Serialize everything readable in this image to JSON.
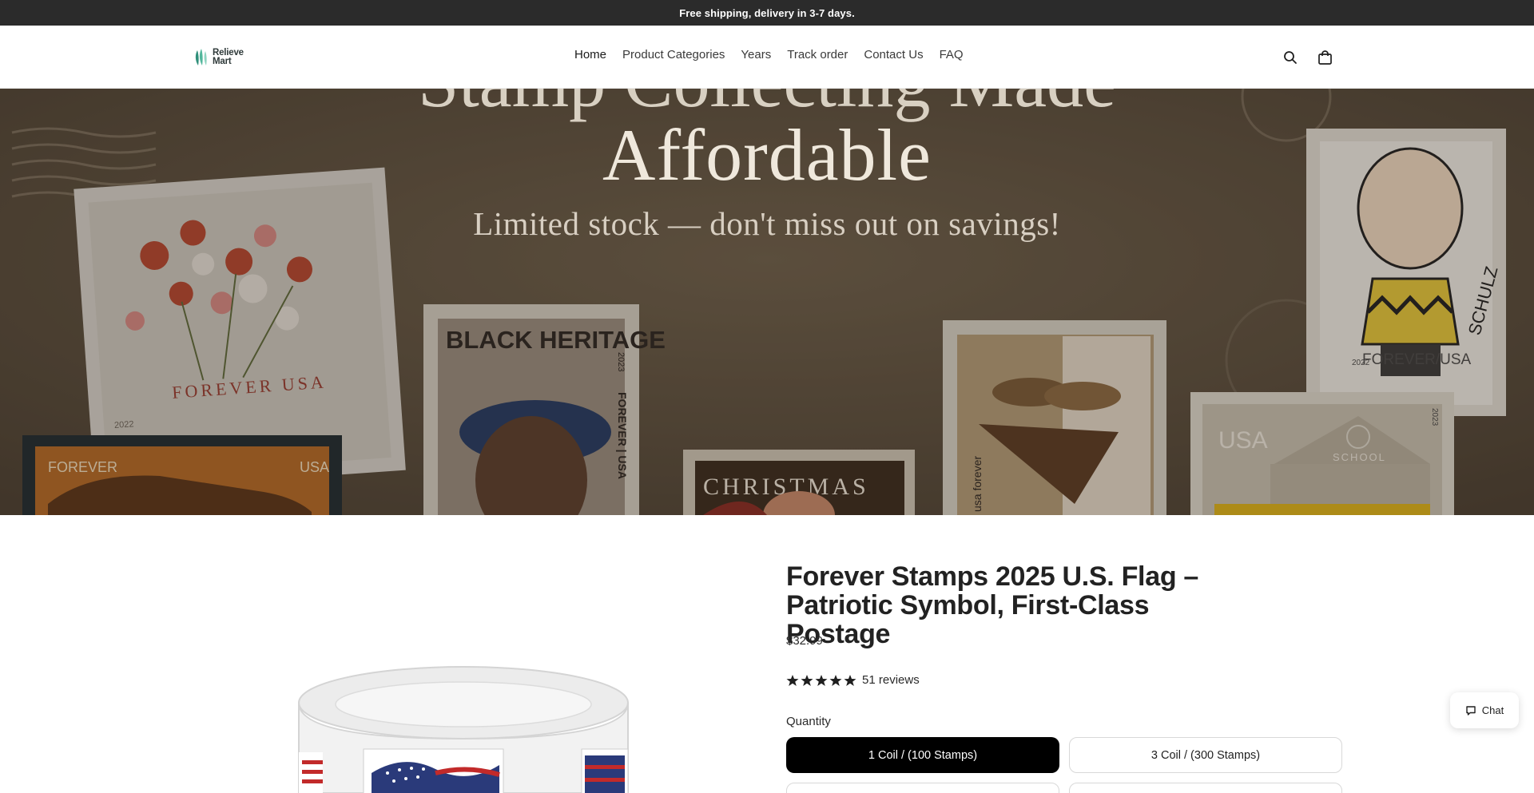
{
  "announcement": {
    "text": "Free shipping, delivery in 3-7 days."
  },
  "logo": {
    "line1": "Relieve",
    "line2": "Mart"
  },
  "nav": {
    "items": [
      {
        "label": "Home"
      },
      {
        "label": "Product Categories"
      },
      {
        "label": "Years"
      },
      {
        "label": "Track order"
      },
      {
        "label": "Contact Us"
      },
      {
        "label": "FAQ"
      }
    ]
  },
  "header_icons": {
    "search": "search-icon",
    "cart": "bag-icon"
  },
  "hero": {
    "title_cut": "Stamp Collecting Made",
    "title": "Affordable",
    "subtitle": "Limited stock — don't miss out on savings!",
    "stamps": {
      "flowers": "FOREVER USA",
      "flowers_year": "2022",
      "car_left": "FOREVER",
      "car_right": "USA",
      "heritage": "BLACK HERITAGE",
      "heritage_side": "FOREVER | USA",
      "heritage_year": "2023",
      "christmas": "CHRISTMAS",
      "basket_side": "usa forever",
      "peanuts_text": "FOREVER/USA",
      "peanuts_year": "2022",
      "peanuts_sign": "SCHULZ",
      "school_usa": "USA",
      "school": "SCHOOL",
      "school_year": "2023"
    }
  },
  "product": {
    "title": "Forever Stamps 2025 U.S. Flag – Patriotic Symbol, First-Class Postage",
    "price": "$32.99",
    "rating": 5,
    "reviews": "51 reviews",
    "quantity_label": "Quantity",
    "options": [
      {
        "label": "1 Coil / (100 Stamps)",
        "selected": true
      },
      {
        "label": "3 Coil / (300 Stamps)",
        "selected": false
      },
      {
        "label": "",
        "selected": false
      },
      {
        "label": "",
        "selected": false
      }
    ]
  },
  "chat": {
    "label": "Chat"
  },
  "colors": {
    "announce_bg": "#2b2b2b",
    "selected_option": "#000000",
    "accent_logo": "#2f8f7a"
  }
}
